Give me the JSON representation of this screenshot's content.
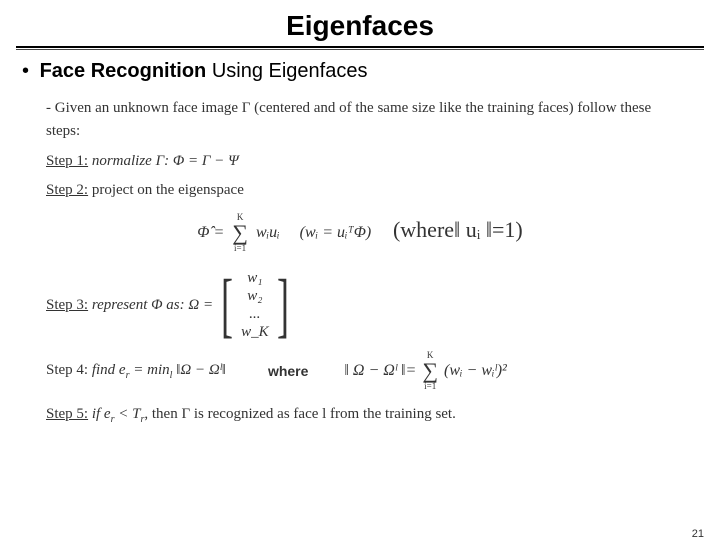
{
  "title": "Eigenfaces",
  "bullet": {
    "strong": "Face Recognition",
    "rest": " Using Eigenfaces"
  },
  "intro": "- Given an unknown face image Γ (centered and of the same size like the training faces) follow these steps:",
  "steps": {
    "s1": {
      "label": "Step 1:",
      "text": " normalize Γ:   Φ = Γ − Ψ"
    },
    "s2": {
      "label": "Step 2:",
      "text": " project on the eigenspace"
    },
    "s3": {
      "label": "Step 3:",
      "pre": " represent Φ as:   Ω ="
    },
    "s4": {
      "label": "Step 4:",
      "text": " find e",
      "rsub": "r",
      "eqpart": " = min",
      "lsub": "l",
      "norm": " ‖Ω − Ωˡ‖"
    },
    "s5": {
      "label": "Step 5:",
      "text1": " if e",
      "cond": " < T",
      "text2": ",  then Γ is recognized as face l from the training set."
    }
  },
  "eq_center": {
    "phi_hat_lhs": "Φ̂ =",
    "sum_top": "K",
    "sum_bot": "i=1",
    "term": "wᵢuᵢ",
    "paren_w": "(wᵢ = uᵢᵀΦ)",
    "where_u": "(where‖ uᵢ ‖=1)"
  },
  "vector": {
    "r1": "w₁",
    "r2": "w₂",
    "r3": "...",
    "r4": "w_K"
  },
  "where_label": "where",
  "norm_rhs": {
    "lhs": "‖ Ω − Ωˡ ‖=",
    "sum_top": "K",
    "sum_bot": "i=1",
    "inside": "(wᵢ − wᵢˡ)²"
  },
  "page": "21"
}
